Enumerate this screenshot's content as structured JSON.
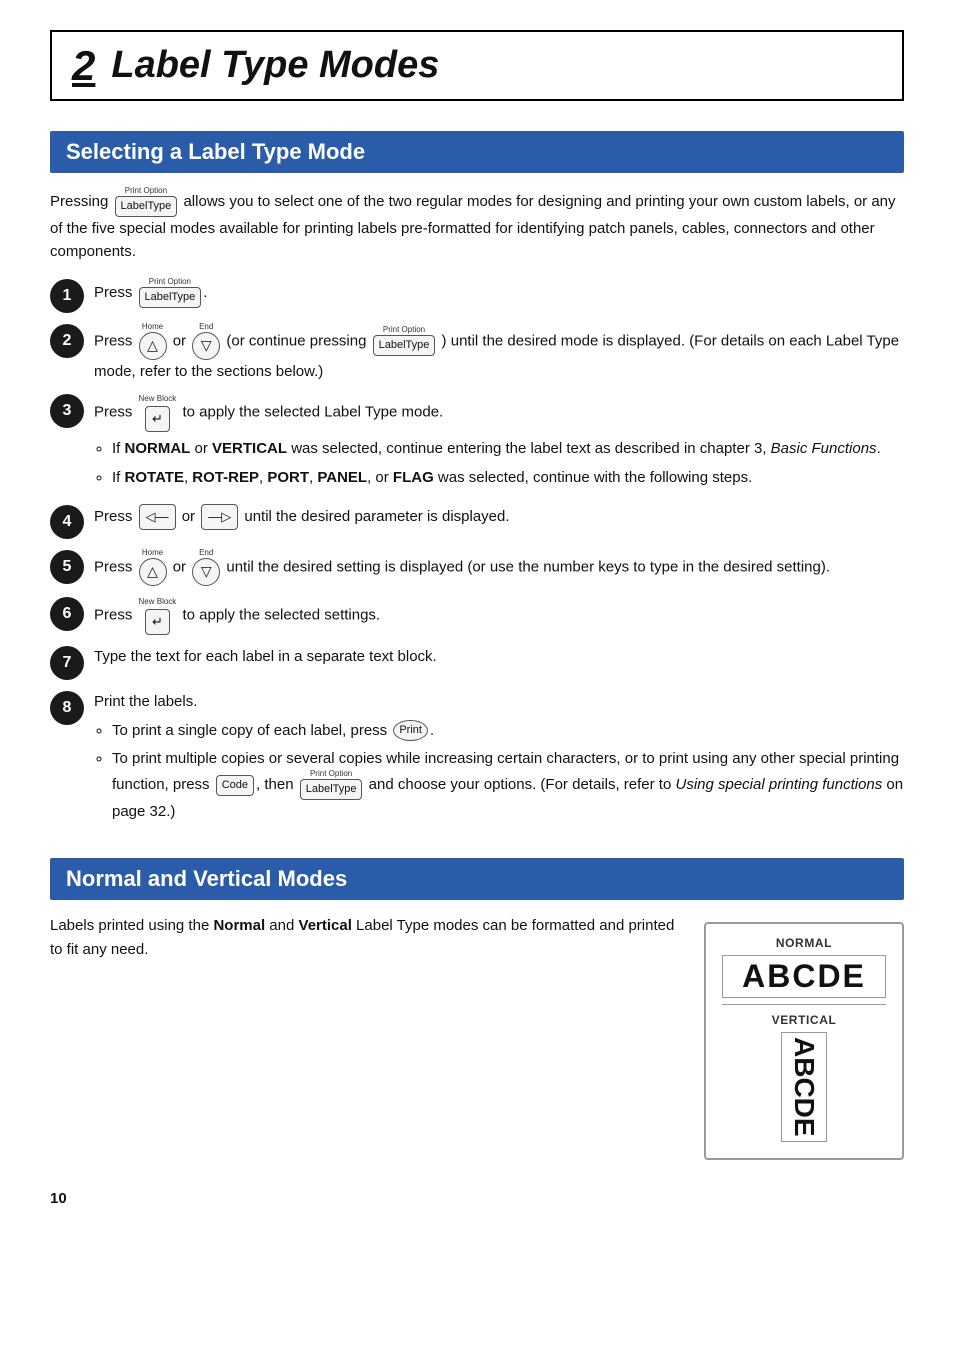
{
  "chapter": {
    "number": "2",
    "title": "Label Type Modes"
  },
  "section1": {
    "header": "Selecting a Label Type Mode",
    "intro": "Pressing  allows you to select one of the two regular modes for designing and printing your own custom labels, or any of the five special modes available for printing labels pre-formatted for identifying patch panels, cables, connectors and other components.",
    "steps": [
      {
        "num": "1",
        "text": "Press ."
      },
      {
        "num": "2",
        "text": " or  (or continue pressing ) until the desired mode is displayed. (For details on each Label Type mode, refer to the sections below.)"
      },
      {
        "num": "3",
        "text": " to apply the selected Label Type mode.",
        "bullets": [
          "If NORMAL or VERTICAL was selected, continue entering the label text as described in chapter 3, Basic Functions.",
          "If ROTATE, ROT-REP, PORT, PANEL, or FLAG was selected, continue with the following steps."
        ]
      },
      {
        "num": "4",
        "text": " or  until the desired parameter is displayed."
      },
      {
        "num": "5",
        "text": " or  until the desired setting is displayed (or use the number keys to type in the desired setting)."
      },
      {
        "num": "6",
        "text": " to apply the selected settings."
      },
      {
        "num": "7",
        "text": "Type the text for each label in a separate text block."
      },
      {
        "num": "8",
        "text": "Print the labels.",
        "bullets": [
          "To print a single copy of each label, press .",
          "To print multiple copies or several copies while increasing certain characters, or to print using any other special printing function, press , then  and choose your options. (For details, refer to Using special printing functions on page 32.)"
        ]
      }
    ]
  },
  "section2": {
    "header": "Normal and Vertical Modes",
    "intro": "Labels printed using the Normal and Vertical Label Type modes can be formatted and printed to fit any need.",
    "illus": {
      "normal_label": "NORMAL",
      "normal_text": "ABCDE",
      "vertical_label": "VERTICAL",
      "vertical_text": "ABCDE"
    }
  },
  "page_number": "10",
  "keys": {
    "label_type_top": "Print Option",
    "label_type_body": "LabelType",
    "home_label": "Home",
    "end_label": "End",
    "up_arrow": "↑",
    "down_arrow": "↓",
    "new_block_label": "New Block",
    "enter_body": "↵",
    "left_nav_body": "◁",
    "right_nav_body": "▷",
    "print_body": "Print",
    "code_body": "Code"
  }
}
